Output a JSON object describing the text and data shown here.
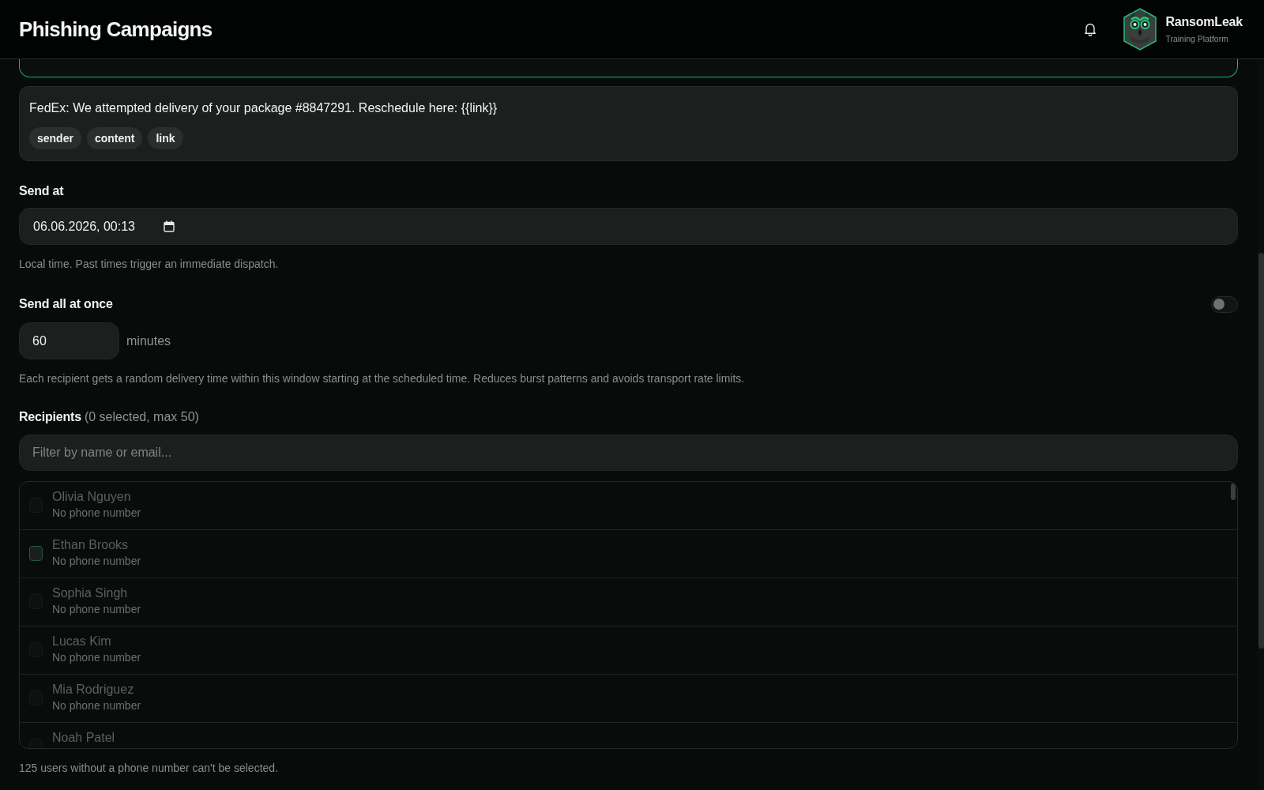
{
  "header": {
    "title": "Phishing Campaigns",
    "brand": {
      "name": "RansomLeak",
      "tagline": "Training Platform"
    }
  },
  "template_select": {
    "focused": true
  },
  "message_preview": {
    "text": "FedEx: We attempted delivery of your package #8847291. Reschedule here: {{link}}",
    "tags": [
      "sender",
      "content",
      "link"
    ]
  },
  "send_at": {
    "label": "Send at",
    "value": "06.06.2026, 00:13",
    "hint": "Local time. Past times trigger an immediate dispatch."
  },
  "send_all_at_once": {
    "label": "Send all at once",
    "on": false,
    "window_value": "60",
    "window_unit": "minutes",
    "hint": "Each recipient gets a random delivery time within this window starting at the scheduled time. Reduces burst patterns and avoids transport rate limits."
  },
  "recipients": {
    "label": "Recipients",
    "count": "(0 selected, max 50)",
    "filter_placeholder": "Filter by name or email...",
    "items": [
      {
        "name": "Olivia Nguyen",
        "detail": "No phone number",
        "checked": false,
        "disabled": true,
        "hovered": false
      },
      {
        "name": "Ethan Brooks",
        "detail": "No phone number",
        "checked": false,
        "disabled": true,
        "hovered": true
      },
      {
        "name": "Sophia Singh",
        "detail": "No phone number",
        "checked": false,
        "disabled": true,
        "hovered": false
      },
      {
        "name": "Lucas Kim",
        "detail": "No phone number",
        "checked": false,
        "disabled": true,
        "hovered": false
      },
      {
        "name": "Mia Rodriguez",
        "detail": "No phone number",
        "checked": false,
        "disabled": true,
        "hovered": false
      },
      {
        "name": "Noah Patel",
        "checked": false,
        "disabled": true,
        "hovered": false
      }
    ],
    "footnote": "125 users without a phone number can't be selected."
  }
}
